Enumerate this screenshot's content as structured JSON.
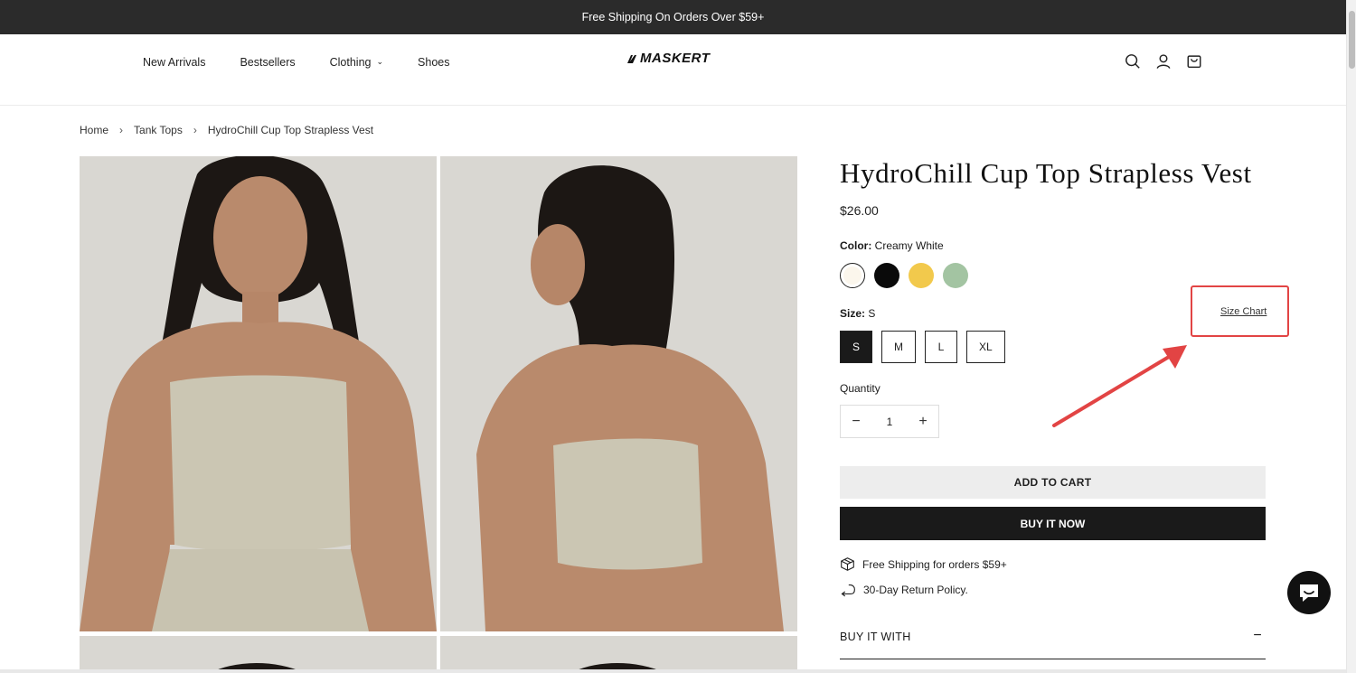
{
  "announcement": "Free Shipping On Orders Over $59+",
  "nav": {
    "items": [
      {
        "label": "New Arrivals"
      },
      {
        "label": "Bestsellers"
      },
      {
        "label": "Clothing"
      },
      {
        "label": "Shoes"
      }
    ]
  },
  "logo": "MASKERT",
  "header_icons": [
    "search-icon",
    "account-icon",
    "cart-icon"
  ],
  "breadcrumb": [
    "Home",
    "Tank Tops",
    "HydroChill Cup Top Strapless Vest"
  ],
  "product": {
    "title": "HydroChill Cup Top Strapless Vest",
    "price": "$26.00",
    "color_label": "Color:",
    "color_value": "Creamy White",
    "swatches": [
      "#fbf6ec",
      "#0a0a0a",
      "#f2c94c",
      "#a3c4a2"
    ],
    "size_label": "Size:",
    "size_value": "S",
    "sizes": [
      "S",
      "M",
      "L",
      "XL"
    ],
    "size_chart": "Size Chart",
    "quantity_label": "Quantity",
    "quantity_value": "1",
    "add_to_cart": "ADD TO CART",
    "buy_it_now": "BUY IT NOW",
    "perks": [
      "Free Shipping for orders $59+",
      "30-Day Return Policy."
    ],
    "accordion_title": "BUY IT WITH"
  },
  "colors": {
    "annotation": "#e24444",
    "primary": "#1a1a1a"
  }
}
